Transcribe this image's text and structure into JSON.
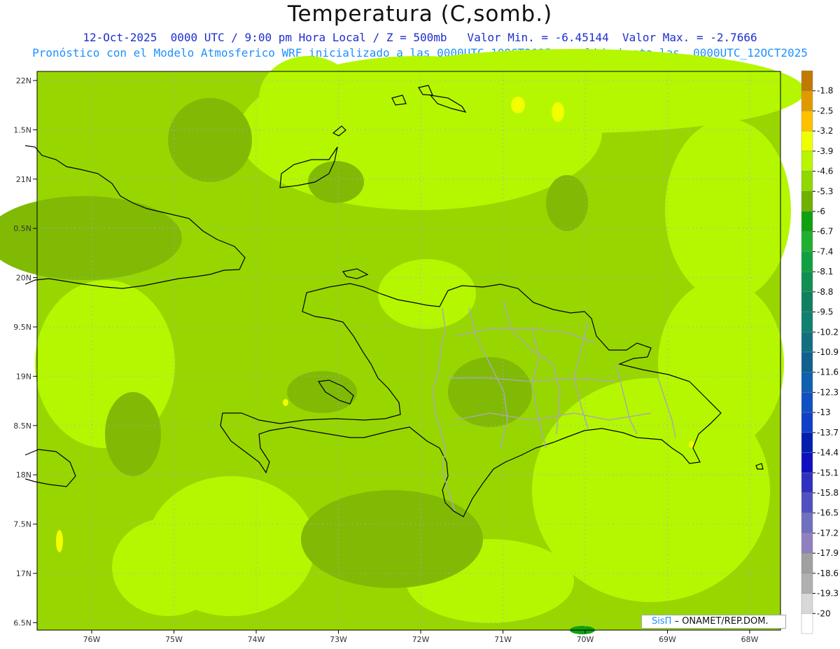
{
  "header": {
    "title": "Temperatura (C,somb.)",
    "subtitle_line1": "12-Oct-2025  0000 UTC / 9:00 pm Hora Local / Z = 500mb   Valor Min. = -6.45144  Valor Max. = -2.7666",
    "subtitle_line2": "Pronóstico con el Modelo Atmosferico WRF inicializado a las 0000UTC_10OCT2025 y valido hasta las  0000UTC_12OCT2025"
  },
  "axes": {
    "lat_labels": [
      "22N",
      "1.5N",
      "21N",
      "0.5N",
      "20N",
      "9.5N",
      "19N",
      "8.5N",
      "18N",
      "7.5N",
      "17N",
      "6.5N"
    ],
    "lon_labels": [
      "76W",
      "75W",
      "74W",
      "73W",
      "72W",
      "71W",
      "70W",
      "69W",
      "68W"
    ]
  },
  "colorbar": {
    "labels": [
      "-1.8",
      "-2.5",
      "-3.2",
      "-3.9",
      "-4.6",
      "-5.3",
      "-6",
      "-6.7",
      "-7.4",
      "-8.1",
      "-8.8",
      "-9.5",
      "-10.2",
      "-10.9",
      "-11.6",
      "-12.3",
      "-13",
      "-13.7",
      "-14.4",
      "-15.1",
      "-15.8",
      "-16.5",
      "-17.2",
      "-17.9",
      "-18.6",
      "-19.3",
      "-20"
    ],
    "colors": [
      "#c07a00",
      "#e09a00",
      "#ffc000",
      "#f0ff00",
      "#b8f500",
      "#8fd800",
      "#70b000",
      "#10a010",
      "#20b030",
      "#10a040",
      "#109050",
      "#108060",
      "#108070",
      "#107080",
      "#106090",
      "#1060b0",
      "#1050c0",
      "#1040c8",
      "#0020b0",
      "#1010c0",
      "#3030c0",
      "#5050c0",
      "#7070c0",
      "#9080c0",
      "#a0a0a0",
      "#b0b0b0",
      "#d8d8d8",
      "#ffffff"
    ]
  },
  "watermark": {
    "brand": "SisΠ",
    "text": "– ONAMET/REP.DOM."
  },
  "colors": {
    "field_base": "#98d600",
    "field_light": "#b4f700",
    "field_dark": "#80ba05",
    "grid": "#a0a8f0",
    "coast": "#000000",
    "provinces": "#aaaaaa"
  }
}
